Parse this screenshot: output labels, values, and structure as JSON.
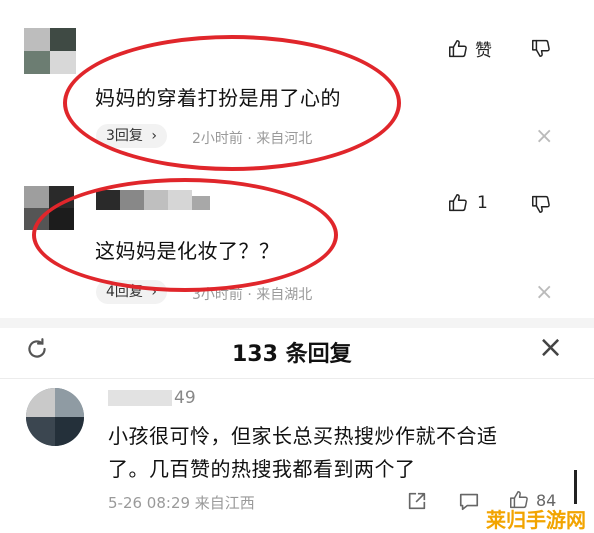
{
  "comments": [
    {
      "text": "妈妈的穿着打扮是用了心的",
      "replies_label": "3回复",
      "meta": "2小时前 · 来自河北",
      "like_label": "赞"
    },
    {
      "text": "这妈妈是化妆了？？",
      "replies_label": "4回复",
      "meta": "3小时前 · 来自湖北",
      "like_count": "1"
    }
  ],
  "reply_sheet": {
    "title": "133 条回复",
    "reply": {
      "username_fragment": "49",
      "text_line1": "小孩很可怜，但家长总买热搜炒作就不合适",
      "text_line2": "了。几百赞的热搜我都看到两个了",
      "meta": "5-26 08:29 来自江西",
      "like_count": "84"
    }
  },
  "watermark": "莱归手游网",
  "colors": {
    "annotation": "#e0262b",
    "muted": "#9a9a9a",
    "watermark": "#f2a400"
  }
}
